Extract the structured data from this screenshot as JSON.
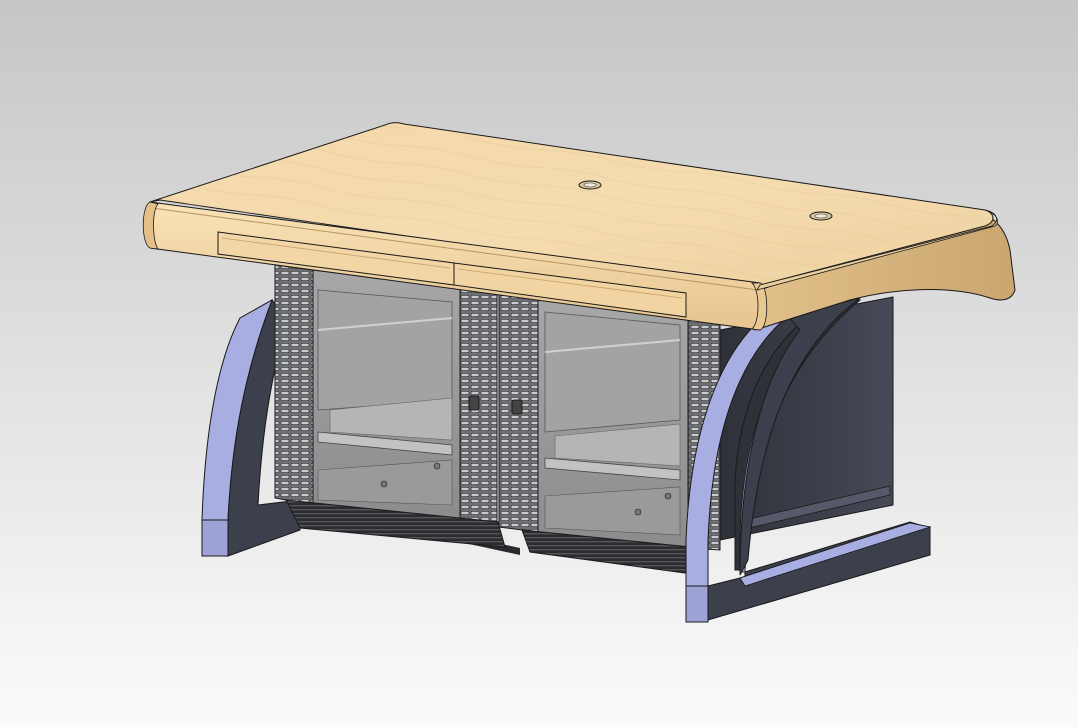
{
  "scene": {
    "subject": "",
    "colors": {
      "background_top": "#c6c6c6",
      "background_bottom": "#fbfbfb",
      "wood_light": "#f6dcae",
      "wood_mid": "#ebc894",
      "wood_dark": "#c9a672",
      "leg_face": "#a9aee2",
      "leg_side": "#3c3f4c",
      "leg_dark": "#2d2f38",
      "rack_frame": "#8e8f94",
      "rack_glass": "#9c9c9c",
      "rack_dark": "#3a3a3e",
      "outline": "#1a1a1a"
    },
    "parts": [
      "desktop",
      "desk-edge-front",
      "cable-grommet-left",
      "cable-grommet-right",
      "front-panel-left",
      "front-panel-right",
      "leg-left",
      "leg-right",
      "rear-panel",
      "rack-cabinet-left",
      "rack-cabinet-right"
    ]
  }
}
